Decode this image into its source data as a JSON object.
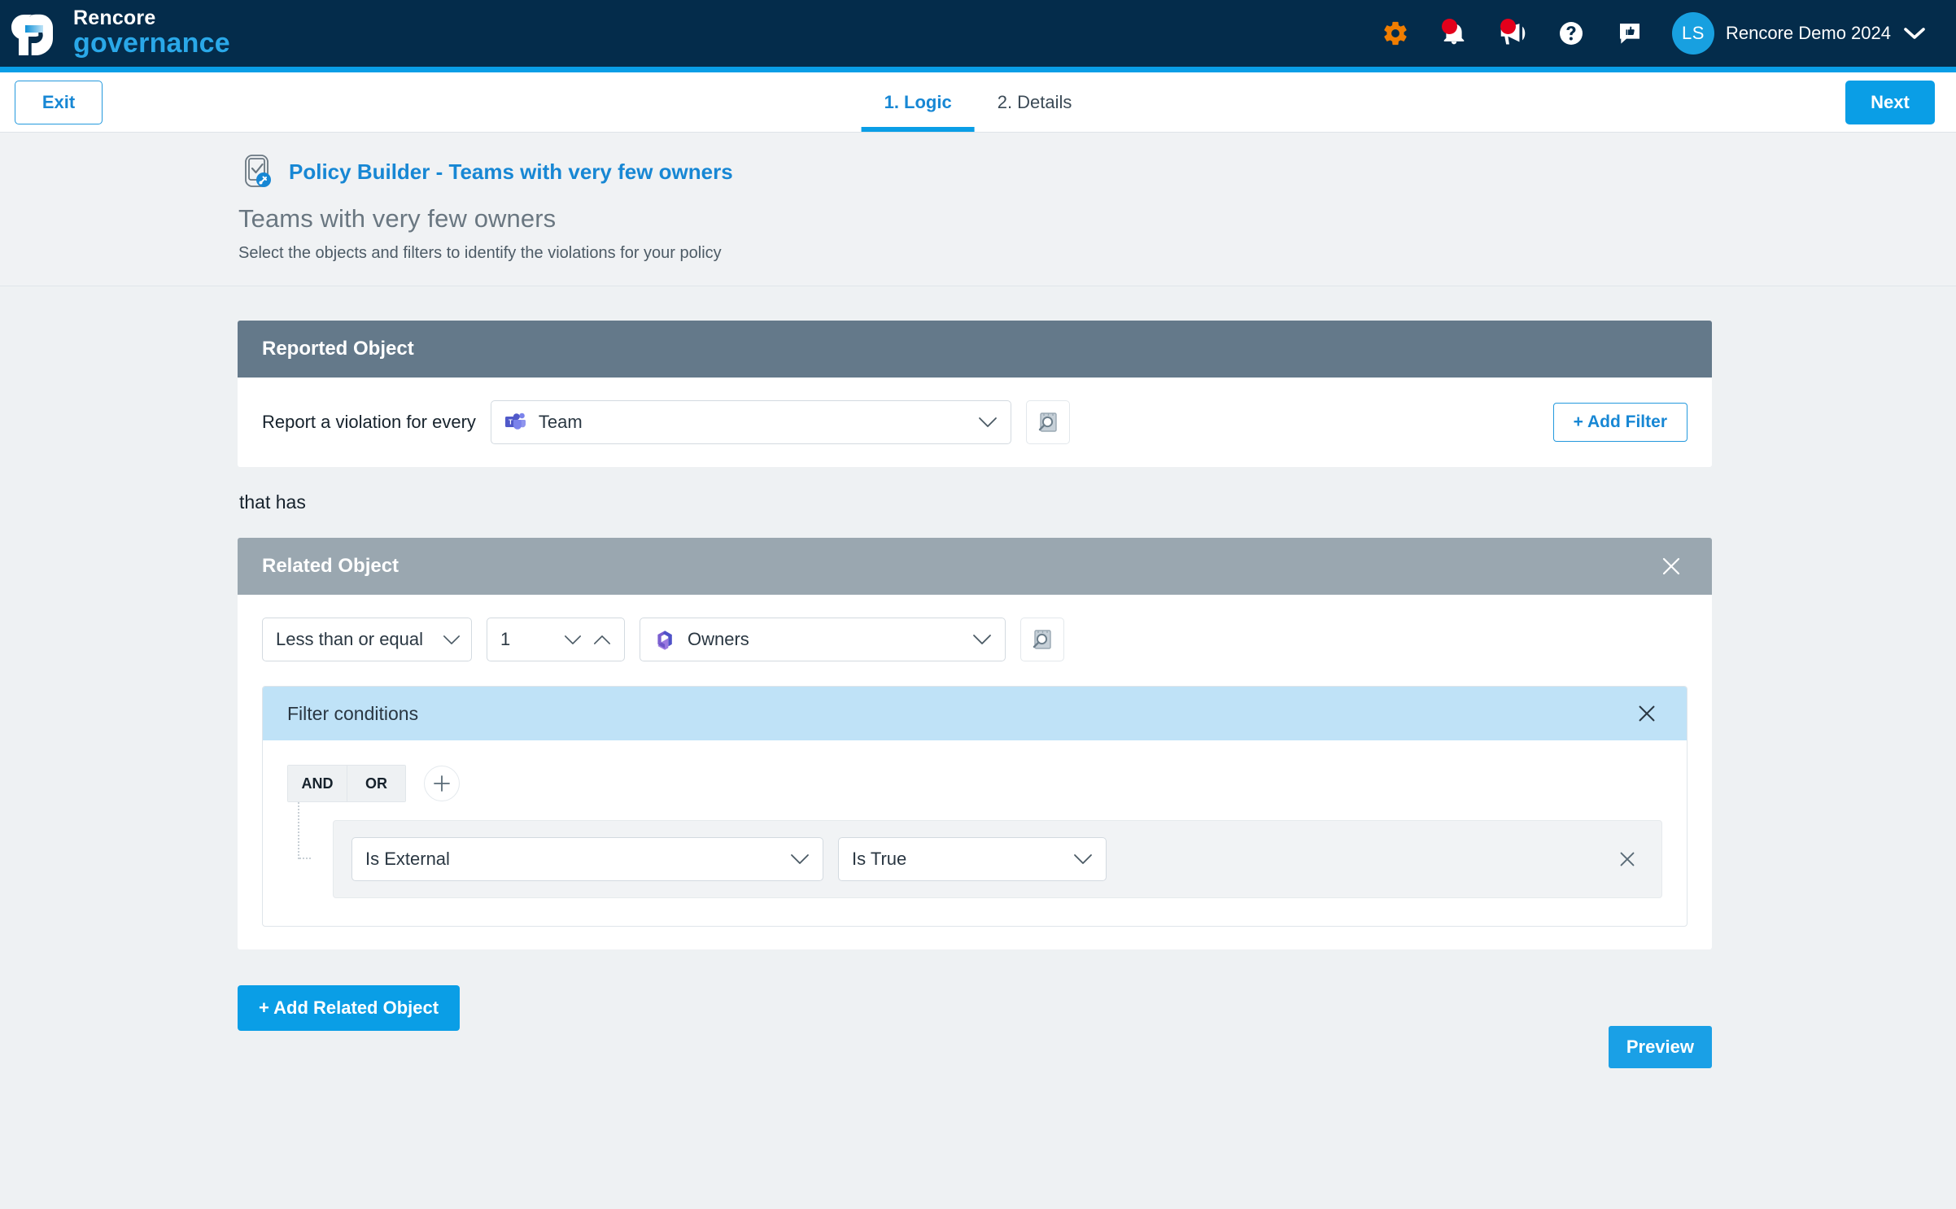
{
  "topnav": {
    "brand_line1": "Rencore",
    "brand_line2": "governance",
    "icons": [
      {
        "name": "settings-gear-icon",
        "badge": false
      },
      {
        "name": "notification-bell-icon",
        "badge": true
      },
      {
        "name": "announcement-megaphone-icon",
        "badge": true
      },
      {
        "name": "help-question-icon",
        "badge": false
      },
      {
        "name": "feedback-chat-icon",
        "badge": false
      }
    ],
    "avatar_initials": "LS",
    "tenant_name": "Rencore Demo 2024",
    "accent_color": "#0a9ee6",
    "background_color": "#042c4b"
  },
  "wizard": {
    "exit_label": "Exit",
    "next_label": "Next",
    "steps": [
      {
        "label": "1. Logic",
        "active": true
      },
      {
        "label": "2. Details",
        "active": false
      }
    ]
  },
  "page": {
    "breadcrumb": "Policy Builder - Teams with very few owners",
    "title": "Teams with very few owners",
    "subtitle": "Select the objects and filters to identify the violations for your policy"
  },
  "reported_object": {
    "header": "Reported Object",
    "prefix_label": "Report a violation for every",
    "object_value": "Team",
    "object_icon": "microsoft-teams-icon",
    "inspect_icon": "inspect-magnifier-icon",
    "add_filter_label": "+ Add Filter"
  },
  "connector_text": "that has",
  "related_object": {
    "header": "Related Object",
    "operator_value": "Less than or equal",
    "count_value": "1",
    "object_value": "Owners",
    "object_icon": "microsoft-365-icon",
    "inspect_icon": "inspect-magnifier-icon",
    "filter_conditions": {
      "header": "Filter conditions",
      "logic_and": "AND",
      "logic_or": "OR",
      "conditions": [
        {
          "field": "Is External",
          "operator": "Is True"
        }
      ]
    }
  },
  "footer": {
    "add_related_object_label": "+ Add Related Object",
    "preview_label": "Preview"
  }
}
